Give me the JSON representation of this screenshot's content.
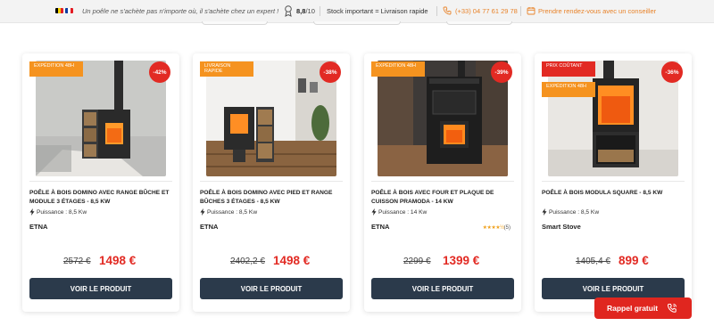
{
  "topbar": {
    "slogan": "Un poêle ne s'achète pas n'importe où, il s'achète chez un expert !",
    "rating": "8,8",
    "rating_max": "/10",
    "stock": "Stock important = Livraison rapide",
    "phone": "(+33) 04 77 61 29 78",
    "appointment": "Prendre rendez-vous avec un conseiller",
    "accent": "#e8832a"
  },
  "products": [
    {
      "badges": [
        "EXPÉDITION 48H"
      ],
      "discount": "-42%",
      "title": "POÊLE À BOIS DOMINO AVEC RANGE BÛCHE ET MODULE 3 ÉTAGES - 8,5 KW",
      "power": "Puissance : 8,5 Kw",
      "brand": "ETNA",
      "old_price": "2572 €",
      "price": "1498 €",
      "button": "VOIR LE PRODUIT"
    },
    {
      "badges": [
        "LIVRAISON RAPIDE"
      ],
      "discount": "-38%",
      "title": "POÊLE À BOIS DOMINO AVEC PIED ET RANGE BÛCHES 3 ÉTAGES - 8,5 KW",
      "power": "Puissance : 8,5 Kw",
      "brand": "ETNA",
      "old_price": "2402,2 €",
      "price": "1498 €",
      "button": "VOIR LE PRODUIT"
    },
    {
      "badges": [
        "EXPÉDITION 48H"
      ],
      "discount": "-39%",
      "title": "POÊLE À BOIS AVEC FOUR ET PLAQUE DE CUISSON PRAMODA - 14 KW",
      "power": "Puissance : 14 Kw",
      "brand": "ETNA",
      "rating_stars": 4.5,
      "reviews": "(5)",
      "old_price": "2299 €",
      "price": "1399 €",
      "button": "VOIR LE PRODUIT"
    },
    {
      "badges": [
        "PRIX COÛTANT",
        "EXPÉDITION 48H"
      ],
      "discount": "-36%",
      "title": "POÊLE À BOIS MODULA SQUARE - 8,5 KW",
      "power": "Puissance : 8,5 Kw",
      "brand": "Smart Stove",
      "old_price": "1405,4 €",
      "price": "899 €",
      "button": "VOIR LE PRODUIT"
    }
  ],
  "callback": {
    "label": "Rappel gratuit"
  },
  "colors": {
    "badge_orange": "#f5931f",
    "badge_red": "#e22a23",
    "button": "#2b3a4b",
    "price": "#e22a23"
  }
}
